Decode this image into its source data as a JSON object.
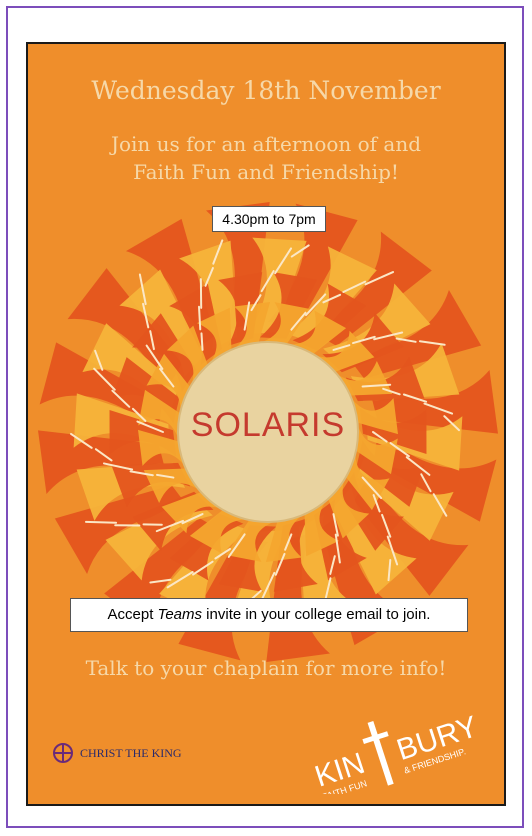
{
  "poster": {
    "date": "Wednesday 18th November",
    "invite_line1": "Join us for an afternoon of and",
    "invite_line2": "Faith Fun and Friendship!",
    "time": "4.30pm to 7pm",
    "center_title": "SOLARIS",
    "teams_before": "Accept ",
    "teams_em": "Teams",
    "teams_after": " invite in your college email to join.",
    "chaplain": "Talk to your chaplain for more info!",
    "ctk_label": "CHRIST THE KING",
    "kint_a": "KIN",
    "kint_b": "BURY",
    "kint_tag_left": "FAITH FUN",
    "kint_tag_right": "& FRIENDSHIP."
  },
  "colors": {
    "background": "#ef8e2b",
    "frame": "#7c4dbb",
    "title_text": "#f6d8a8",
    "solaris_text": "#c53a2e",
    "sun_core": "#e9d3a0"
  }
}
